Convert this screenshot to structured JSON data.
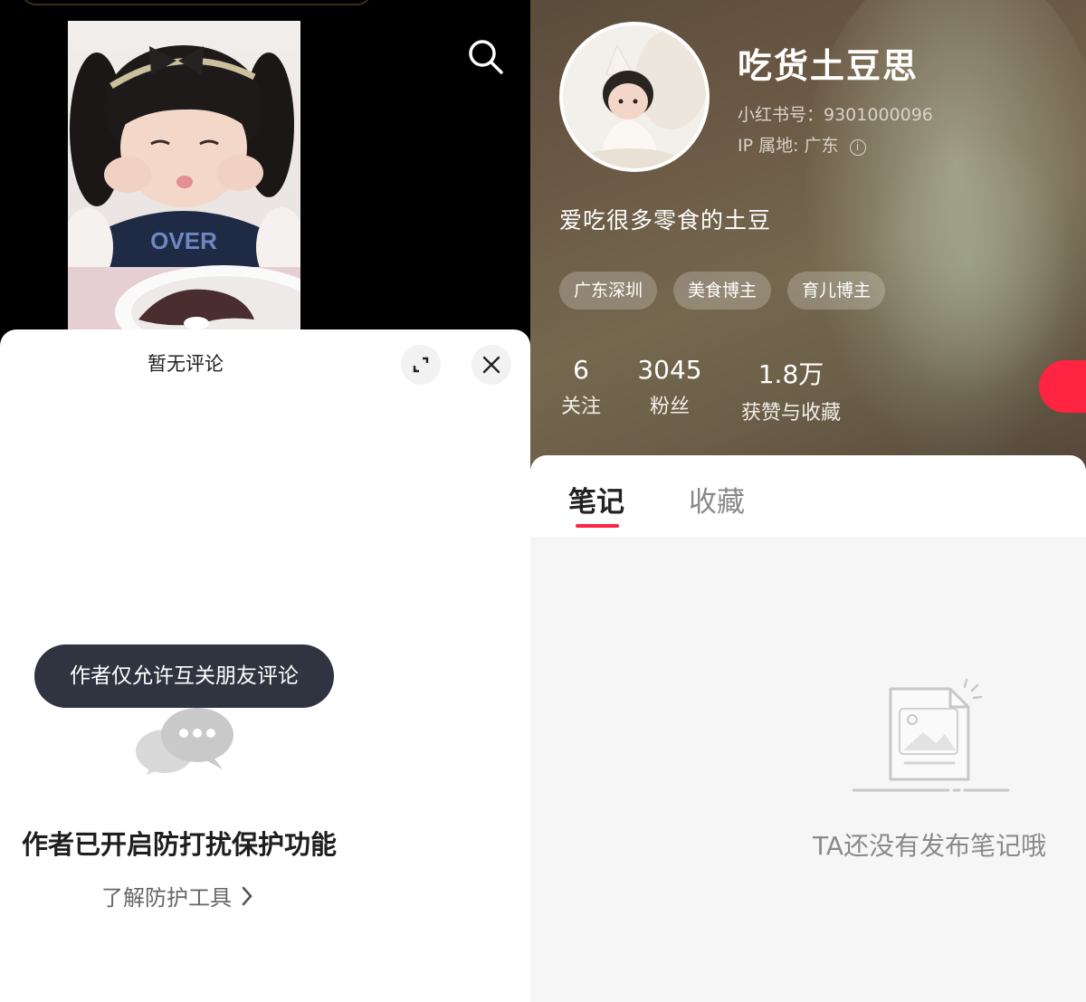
{
  "left": {
    "search_icon": "search-icon",
    "comment_sheet": {
      "title": "暂无评论",
      "expand_icon": "expand-icon",
      "close_icon": "close-icon",
      "tooltip": "作者仅允许互关朋友评论",
      "empty_icon": "chat-bubbles-icon",
      "protection_title": "作者已开启防打扰保护功能",
      "learn_link": "了解防护工具"
    }
  },
  "profile": {
    "nickname": "吃货土豆思",
    "redid": "小红书号：9301000096",
    "ip_location": "IP 属地: 广东",
    "bio": "爱吃很多零食的土豆",
    "tags": [
      "广东深圳",
      "美食博主",
      "育儿博主"
    ],
    "stats": [
      {
        "value": "6",
        "label": "关注"
      },
      {
        "value": "3045",
        "label": "粉丝"
      },
      {
        "value": "1.8万",
        "label": "获赞与收藏"
      }
    ]
  },
  "tabs": [
    "笔记",
    "收藏"
  ],
  "empty_state": {
    "icon": "empty-note-image-icon",
    "text": "TA还没有发布笔记哦"
  },
  "colors": {
    "accent": "#ff2442",
    "tooltip_bg": "#2f3440",
    "hero_bg": "#6b5a45"
  }
}
